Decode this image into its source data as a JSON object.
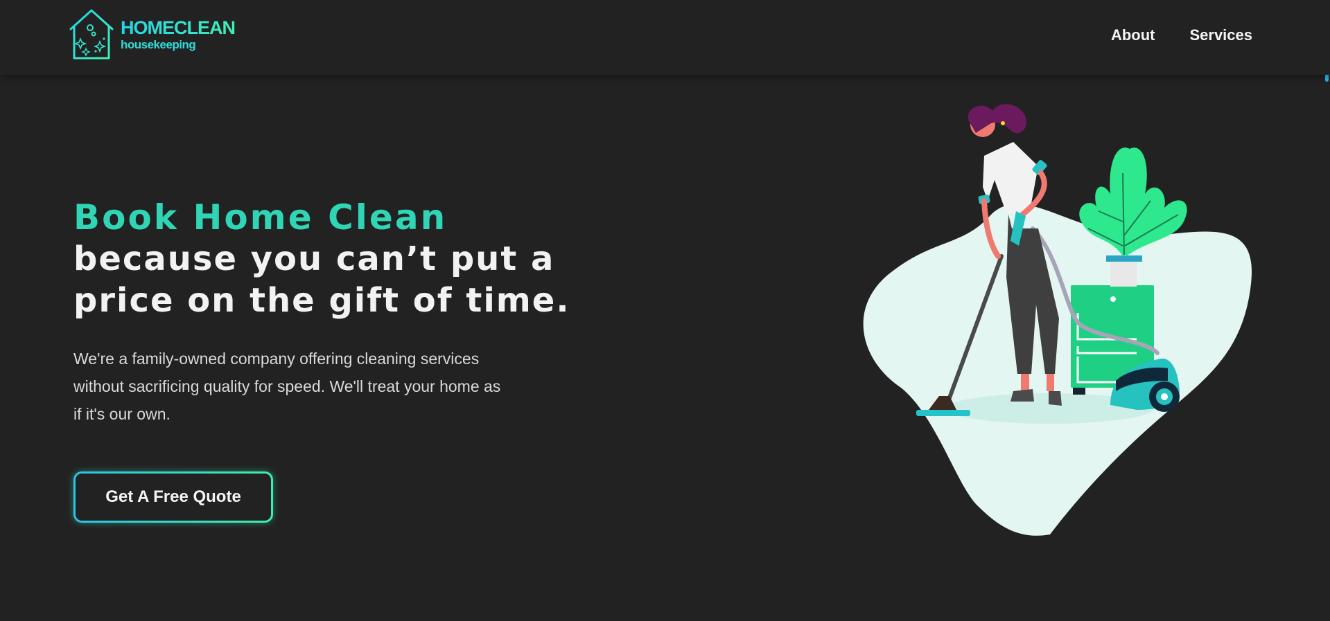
{
  "header": {
    "logo": {
      "title": "HOMECLEAN",
      "subtitle": "housekeeping",
      "icon": "house-sparkle-icon"
    },
    "nav": [
      {
        "label": "About"
      },
      {
        "label": "Services"
      }
    ]
  },
  "hero": {
    "headline_accent": "Book Home Clean",
    "headline_line1": "because you can’t put a",
    "headline_line2": "price on the gift of time.",
    "body": "We're a family-owned company offering cleaning services without sacrificing quality for speed. We'll treat your home as if it's our own.",
    "cta_label": "Get A Free Quote"
  },
  "illustration": {
    "subject": "woman-vacuuming-illustration"
  },
  "colors": {
    "background": "#222222",
    "accent_cyan": "#23d5e8",
    "accent_green": "#3ff0b8",
    "headline_accent": "#2fd5b5",
    "text_light": "#f2f2f2",
    "blob": "#e3f6f2"
  }
}
